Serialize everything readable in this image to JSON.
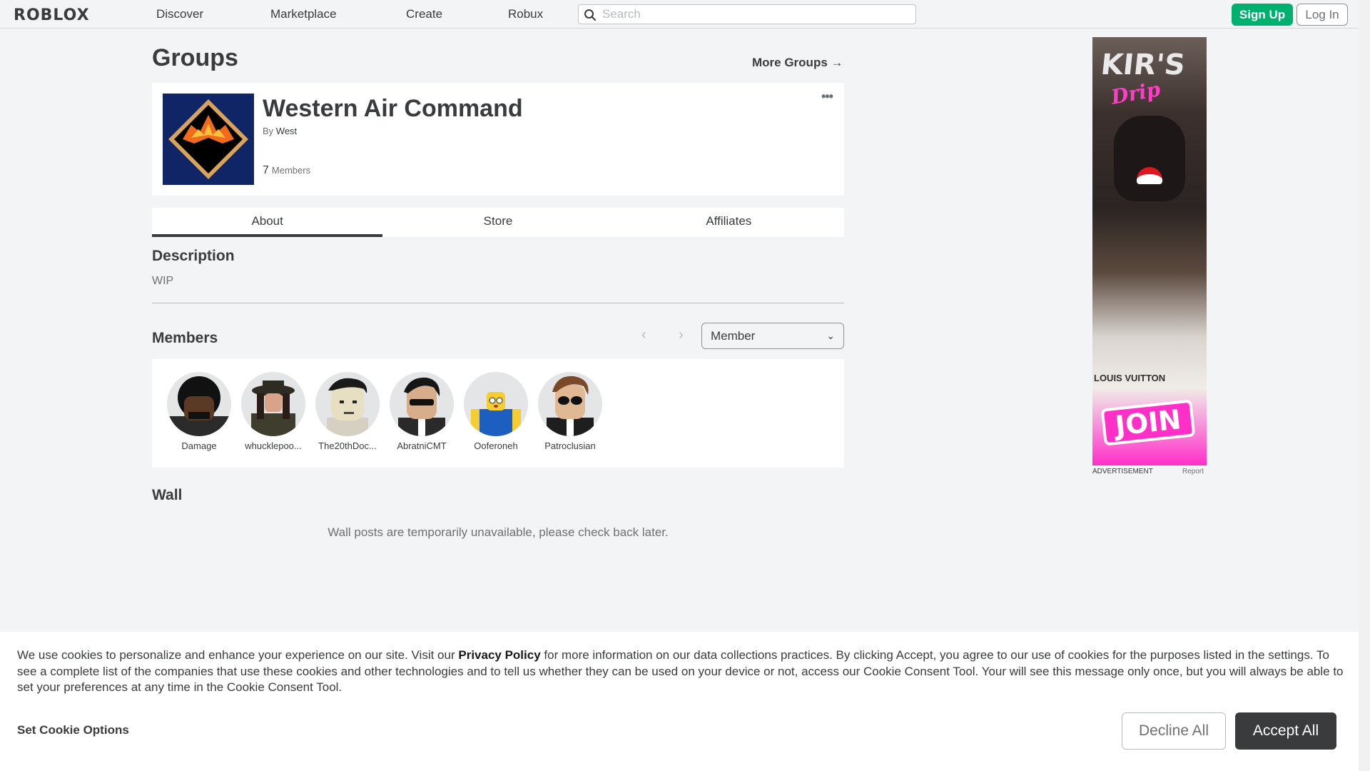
{
  "nav": {
    "logo": "ROBLOX",
    "links": [
      "Discover",
      "Marketplace",
      "Create",
      "Robux"
    ],
    "search_placeholder": "Search",
    "signup": "Sign Up",
    "login": "Log In"
  },
  "page": {
    "title": "Groups",
    "more_groups": "More Groups →"
  },
  "group": {
    "name": "Western Air Command",
    "by_label": "By",
    "owner": "West",
    "member_count": "7",
    "members_label": "Members",
    "menu": "•••"
  },
  "tabs": [
    "About",
    "Store",
    "Affiliates"
  ],
  "description": {
    "heading": "Description",
    "text": "WIP"
  },
  "members": {
    "heading": "Members",
    "role_select": "Member",
    "list": [
      {
        "name": "Damage"
      },
      {
        "name": "whucklepoo..."
      },
      {
        "name": "The20thDoc..."
      },
      {
        "name": "AbratniCMT"
      },
      {
        "name": "Ooferoneh"
      },
      {
        "name": "Patroclusian"
      }
    ]
  },
  "wall": {
    "heading": "Wall",
    "message": "Wall posts are temporarily unavailable, please check back later."
  },
  "ad": {
    "title": "KIR'S",
    "subtitle": "Drip",
    "brand": "LOUIS VUITTON",
    "cta": "JOIN",
    "label": "ADVERTISEMENT",
    "report": "Report"
  },
  "cookie": {
    "text_before": "We use cookies to personalize and enhance your experience on our site. Visit our ",
    "privacy_link": "Privacy Policy",
    "text_after": " for more information on our data collections practices. By clicking Accept, you agree to our use of cookies for the purposes listed in the settings. To see a complete list of the companies that use these cookies and other technologies and to tell us whether they can be used on your device or not, access our Cookie Consent Tool. Your will see this message only once, but you will always be able to set your preferences at any time in the Cookie Consent Tool.",
    "options": "Set Cookie Options",
    "decline": "Decline All",
    "accept": "Accept All"
  },
  "colors": {
    "signup_green": "#00b06f",
    "emblem_navy": "#0f2565",
    "accept_dark": "#393b3d",
    "ad_pink": "#ff2fc8"
  }
}
